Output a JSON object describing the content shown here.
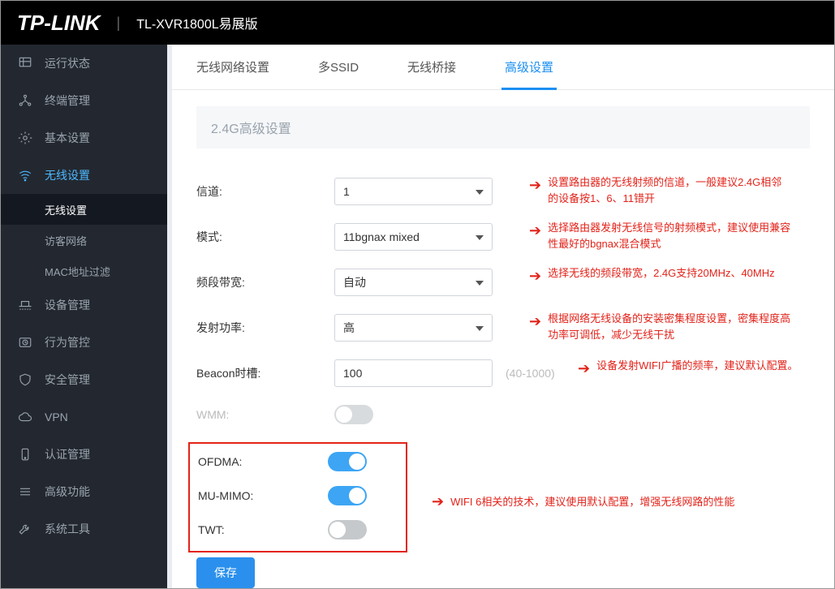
{
  "header": {
    "brand": "TP-LINK",
    "model": "TL-XVR1800L易展版"
  },
  "sidebar": {
    "items": [
      {
        "label": "运行状态",
        "icon": "dashboard"
      },
      {
        "label": "终端管理",
        "icon": "network"
      },
      {
        "label": "基本设置",
        "icon": "gear"
      },
      {
        "label": "无线设置",
        "icon": "wifi",
        "active": true,
        "subs": [
          {
            "label": "无线设置",
            "active": true
          },
          {
            "label": "访客网络"
          },
          {
            "label": "MAC地址过滤"
          }
        ]
      },
      {
        "label": "设备管理",
        "icon": "devices"
      },
      {
        "label": "行为管控",
        "icon": "clock"
      },
      {
        "label": "安全管理",
        "icon": "shield"
      },
      {
        "label": "VPN",
        "icon": "cloud"
      },
      {
        "label": "认证管理",
        "icon": "phone"
      },
      {
        "label": "高级功能",
        "icon": "bars"
      },
      {
        "label": "系统工具",
        "icon": "wrench"
      }
    ]
  },
  "tabs": [
    "无线网络设置",
    "多SSID",
    "无线桥接",
    "高级设置"
  ],
  "activeTab": 3,
  "section": {
    "title": "2.4G高级设置"
  },
  "form": {
    "channel": {
      "label": "信道:",
      "value": "1",
      "note": "设置路由器的无线射频的信道，一般建议2.4G相邻的设备按1、6、11错开"
    },
    "mode": {
      "label": "模式:",
      "value": "11bgnax mixed",
      "note": "选择路由器发射无线信号的射频模式，建议使用兼容性最好的bgnax混合模式"
    },
    "bw": {
      "label": "频段带宽:",
      "value": "自动",
      "note": "选择无线的频段带宽，2.4G支持20MHz、40MHz"
    },
    "power": {
      "label": "发射功率:",
      "value": "高",
      "note": "根据网络无线设备的安装密集程度设置，密集程度高功率可调低，减少无线干扰"
    },
    "beacon": {
      "label": "Beacon时槽:",
      "value": "100",
      "hint": "(40-1000)",
      "note": "设备发射WIFI广播的频率，建议默认配置。"
    },
    "wmm": {
      "label": "WMM:"
    },
    "ofdma": {
      "label": "OFDMA:"
    },
    "mumimo": {
      "label": "MU-MIMO:"
    },
    "twt": {
      "label": "TWT:"
    },
    "wifi6note": "WIFI 6相关的技术，建议使用默认配置，增强无线网路的性能",
    "save": "保存"
  }
}
